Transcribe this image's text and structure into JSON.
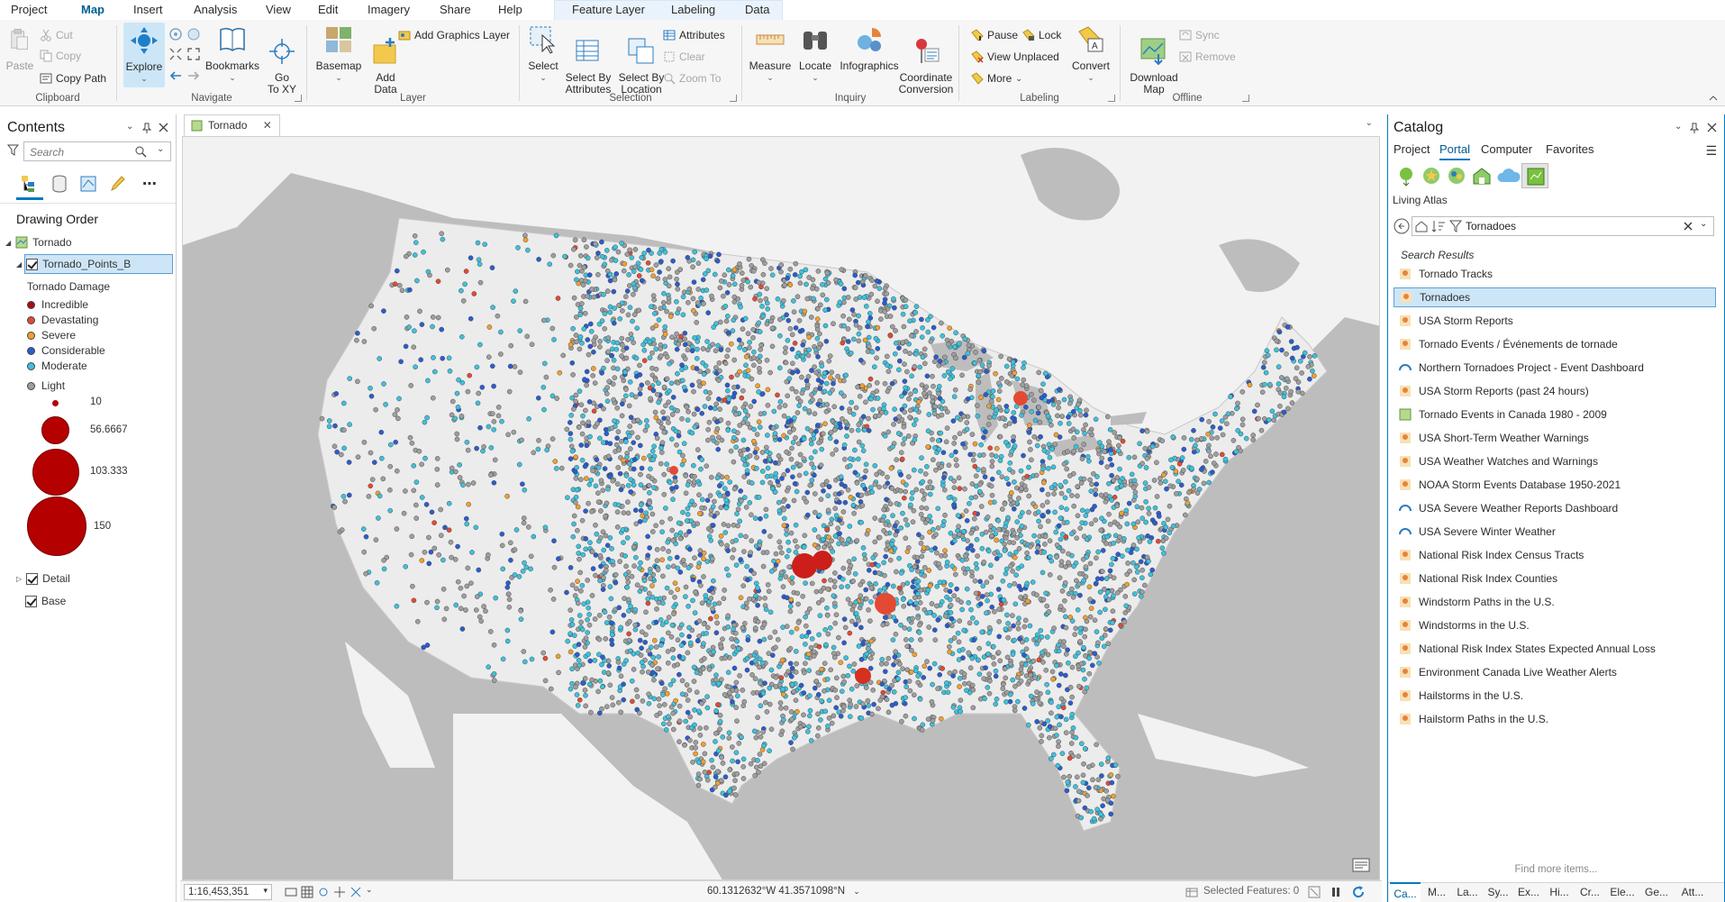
{
  "ribbon": {
    "tabs": [
      "Project",
      "Map",
      "Insert",
      "Analysis",
      "View",
      "Edit",
      "Imagery",
      "Share",
      "Help"
    ],
    "context_tabs": [
      "Feature Layer",
      "Labeling",
      "Data"
    ],
    "clipboard": {
      "label": "Clipboard",
      "paste": "Paste",
      "cut": "Cut",
      "copy": "Copy",
      "copy_path": "Copy Path"
    },
    "navigate": {
      "label": "Navigate",
      "explore": "Explore",
      "bookmarks": "Bookmarks",
      "go_to_xy": "Go\nTo XY"
    },
    "layer": {
      "label": "Layer",
      "basemap": "Basemap",
      "add_data": "Add\nData",
      "add_graphics": "Add Graphics Layer"
    },
    "selection": {
      "label": "Selection",
      "select": "Select",
      "select_by_attr": "Select By\nAttributes",
      "select_by_loc": "Select By\nLocation",
      "attributes": "Attributes",
      "clear": "Clear",
      "zoom_to": "Zoom To"
    },
    "inquiry": {
      "label": "Inquiry",
      "measure": "Measure",
      "locate": "Locate",
      "infographics": "Infographics",
      "coord_conv": "Coordinate\nConversion"
    },
    "labeling": {
      "label": "Labeling",
      "pause": "Pause",
      "lock": "Lock",
      "view_unplaced": "View Unplaced",
      "more": "More",
      "convert": "Convert"
    },
    "offline": {
      "label": "Offline",
      "download_map": "Download\nMap",
      "sync": "Sync",
      "remove": "Remove"
    }
  },
  "contents": {
    "title": "Contents",
    "search_placeholder": "Search",
    "drawing_order": "Drawing Order",
    "map_name": "Tornado",
    "layer_name": "Tornado_Points_B",
    "legend_heading": "Tornado Damage",
    "legend": [
      {
        "label": "Incredible",
        "color": "#a50f15"
      },
      {
        "label": "Devastating",
        "color": "#e34a33"
      },
      {
        "label": "Severe",
        "color": "#f0a030"
      },
      {
        "label": "Considerable",
        "color": "#2c5dcd"
      },
      {
        "label": "Moderate",
        "color": "#3ec1dc"
      },
      {
        "label": "Light",
        "color": "#9e9e9e"
      }
    ],
    "sizes": [
      "10",
      "56.6667",
      "103.333",
      "150"
    ],
    "other_layers": [
      "Detail",
      "Base"
    ]
  },
  "map": {
    "tab_name": "Tornado",
    "scale": "1:16,453,351",
    "coordinates": "60.1312632°W 41.3571098°N",
    "selected_features": "Selected Features: 0"
  },
  "catalog": {
    "title": "Catalog",
    "tabs": [
      "Project",
      "Portal",
      "Computer",
      "Favorites"
    ],
    "section": "Living Atlas",
    "search_value": "Tornadoes",
    "results_heading": "Search Results",
    "results": [
      "Tornado Tracks",
      "Tornadoes",
      "USA Storm Reports",
      "Tornado Events / Événements de tornade",
      "Northern Tornadoes Project - Event Dashboard",
      "USA Storm Reports (past 24 hours)",
      "Tornado Events in Canada 1980 - 2009",
      "USA Short-Term Weather Warnings",
      "USA Weather Watches and Warnings",
      "NOAA Storm Events Database 1950-2021",
      "USA Severe Weather Reports Dashboard",
      "USA Severe Winter Weather",
      "National Risk Index Census Tracts",
      "National Risk Index Counties",
      "Windstorm Paths in the U.S.",
      "Windstorms in the U.S.",
      "National Risk Index States Expected Annual Loss",
      "Environment Canada Live Weather Alerts",
      "Hailstorms in the U.S.",
      "Hailstorm Paths in the U.S."
    ],
    "find_more": "Find more items...",
    "bottom_tabs": [
      "Ca...",
      "M...",
      "La...",
      "Sy...",
      "Ex...",
      "Hi...",
      "Cr...",
      "Ele...",
      "Ge...",
      "Att..."
    ]
  }
}
